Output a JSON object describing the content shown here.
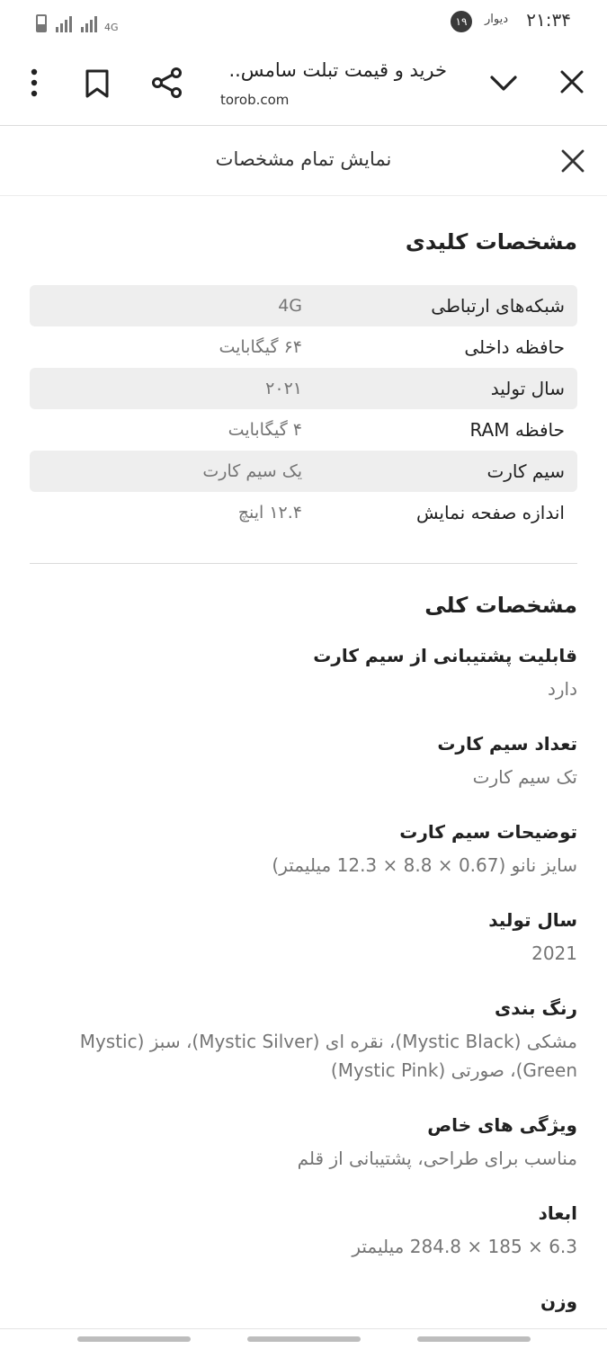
{
  "status_bar": {
    "time": "۲۱:۳۴",
    "app_name": "دیوار",
    "badge_count": "۱۹",
    "network": "4G"
  },
  "toolbar": {
    "title": "خرید و قیمت تبلت سامس..",
    "url": "torob.com"
  },
  "panel": {
    "title": "نمایش تمام مشخصات"
  },
  "key_specs": {
    "title": "مشخصات کلیدی",
    "rows": [
      {
        "label": "شبکه‌های ارتباطی",
        "value": "4G"
      },
      {
        "label": "حافظه داخلی",
        "value": "۶۴ گیگابایت"
      },
      {
        "label": "سال تولید",
        "value": "۲۰۲۱"
      },
      {
        "label": "حافظه RAM",
        "value": "۴ گیگابایت"
      },
      {
        "label": "سیم کارت",
        "value": "یک سیم کارت"
      },
      {
        "label": "اندازه صفحه نمایش",
        "value": "۱۲.۴ اینچ"
      }
    ]
  },
  "general_specs": {
    "title": "مشخصات کلی",
    "items": [
      {
        "label": "قابلیت پشتیبانی از سیم کارت",
        "value": "دارد"
      },
      {
        "label": "تعداد سیم کارت",
        "value": "تک سیم کارت"
      },
      {
        "label": "توضیحات سیم کارت",
        "value": "سایز نانو (0.67 × 8.8 × 12.3 میلیمتر)"
      },
      {
        "label": "سال تولید",
        "value": "2021"
      },
      {
        "label": "رنگ بندی",
        "value": "مشکی (Mystic Black)، نقره ای (Mystic Silver)، سبز (Mystic Green)، صورتی (Mystic Pink)"
      },
      {
        "label": "ویژگی های خاص",
        "value": "مناسب برای طراحی، پشتیبانی از قلم"
      },
      {
        "label": "ابعاد",
        "value": "6.3 × 185 × 284.8 میلیمتر"
      },
      {
        "label": "وزن",
        "value": ""
      }
    ]
  }
}
